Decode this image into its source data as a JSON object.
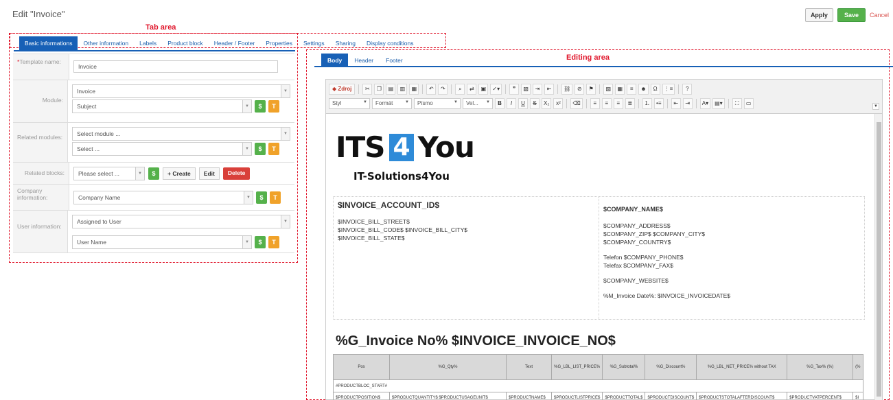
{
  "page": {
    "title": "Edit \"Invoice\""
  },
  "actions": {
    "apply": "Apply",
    "save": "Save",
    "cancel": "Cancel"
  },
  "annotations": {
    "tab_area": "Tab area",
    "editing_area": "Editing area"
  },
  "tabs": [
    {
      "label": "Basic informations",
      "active": true
    },
    {
      "label": "Other information"
    },
    {
      "label": "Labels"
    },
    {
      "label": "Product block"
    },
    {
      "label": "Header / Footer"
    },
    {
      "label": "Properties"
    },
    {
      "label": "Settings"
    },
    {
      "label": "Sharing"
    },
    {
      "label": "Display conditions"
    }
  ],
  "form": {
    "template_name_label": "Template name:",
    "template_name_value": "Invoice",
    "module_label": "Module:",
    "module_value": "Invoice",
    "module_field": "Subject",
    "related_label": "Related modules:",
    "related_module": "Select module ...",
    "related_field": "Select ...",
    "blocks_label": "Related blocks:",
    "blocks_select": "Please select ...",
    "create": "Create",
    "edit": "Edit",
    "delete": "Delete",
    "company_label": "Company information:",
    "company_field": "Company Name",
    "user_label": "User information:",
    "user_module": "Assigned to User",
    "user_field": "User Name",
    "s_glyph": "$",
    "t_glyph": "T"
  },
  "editor_tabs": [
    {
      "label": "Body",
      "active": true
    },
    {
      "label": "Header"
    },
    {
      "label": "Footer"
    }
  ],
  "toolbar": {
    "source": "Zdroj",
    "styl": "Styl",
    "format": "Formát",
    "pismo": "Písmo",
    "vel": "Vel...",
    "omega": "Ω",
    "help": "?",
    "bold": "B",
    "italic": "I",
    "underline": "U",
    "strike": "S",
    "sub": "X₂",
    "sup": "x²"
  },
  "document": {
    "logo_left": "ITS",
    "logo_mid": "4",
    "logo_right": "You",
    "logo_sub": "IT-Solutions4You",
    "account": "$INVOICE_ACCOUNT_ID$",
    "bill_street": "$INVOICE_BILL_STREET$",
    "bill_code_city": "$INVOICE_BILL_CODE$ $INVOICE_BILL_CITY$",
    "bill_state": "$INVOICE_BILL_STATE$",
    "company_name": "$COMPANY_NAME$",
    "company_address": "$COMPANY_ADDRESS$",
    "company_zip_city": "$COMPANY_ZIP$ $COMPANY_CITY$",
    "company_country": "$COMPANY_COUNTRY$",
    "phone": "Telefon $COMPANY_PHONE$",
    "fax": "Telefax $COMPANY_FAX$",
    "website": "$COMPANY_WEBSITE$",
    "invoice_date": "%M_Invoice Date%: $INVOICE_INVOICEDATE$",
    "invoice_no": "%G_Invoice No% $INVOICE_INVOICE_NO$",
    "table_headers": [
      "Pos",
      "%G_Qty%",
      "Text",
      "%G_LBL_LIST_PRICE%",
      "%G_Subtotal%",
      "%G_Discount%",
      "%G_LBL_NET_PRICE% without TAX",
      "%G_Tax% (%)",
      "(%"
    ],
    "productbloc_start": "#PRODUCTBLOC_START#",
    "table_row": [
      "$PRODUCTPOSITION$",
      "$PRODUCTQUANTITY$ $PRODUCTUSAGEUNIT$",
      "$PRODUCTNAME$",
      "$PRODUCTLISTPRICE$",
      "$PRODUCTTOTAL$",
      "$PRODUCTDISCOUNT$",
      "$PRODUCTSTOTALAFTERDISCOUNT$",
      "$PRODUCTVATPERCENT$",
      "$I"
    ]
  }
}
